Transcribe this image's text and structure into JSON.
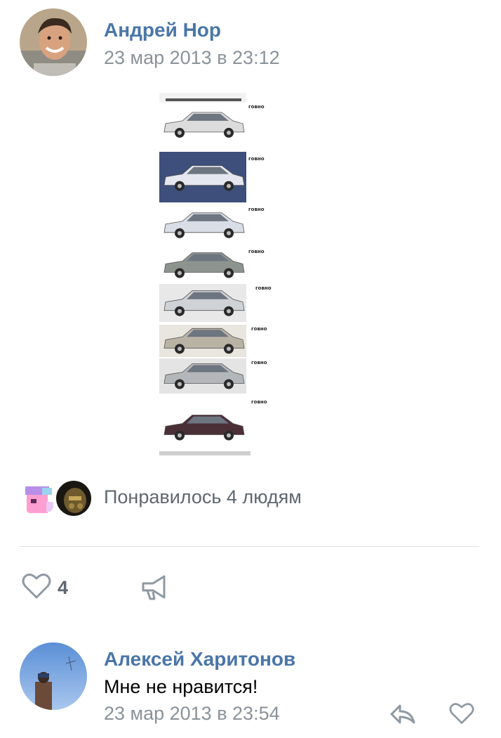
{
  "post": {
    "author": "Андрей Нор",
    "date": "23 мар 2013 в 23:12",
    "image": {
      "icon": "cars-collage-image",
      "label": "говно"
    },
    "likes_summary": "Понравилось 4 людям",
    "like_count": "4"
  },
  "comment": {
    "author": "Алексей Харитонов",
    "text": "Мне не нравится!",
    "date": "23 мар 2013 в 23:54"
  },
  "colors": {
    "link": "#4a76a8",
    "secondary": "#8a929b",
    "icon": "#8e99a4"
  }
}
